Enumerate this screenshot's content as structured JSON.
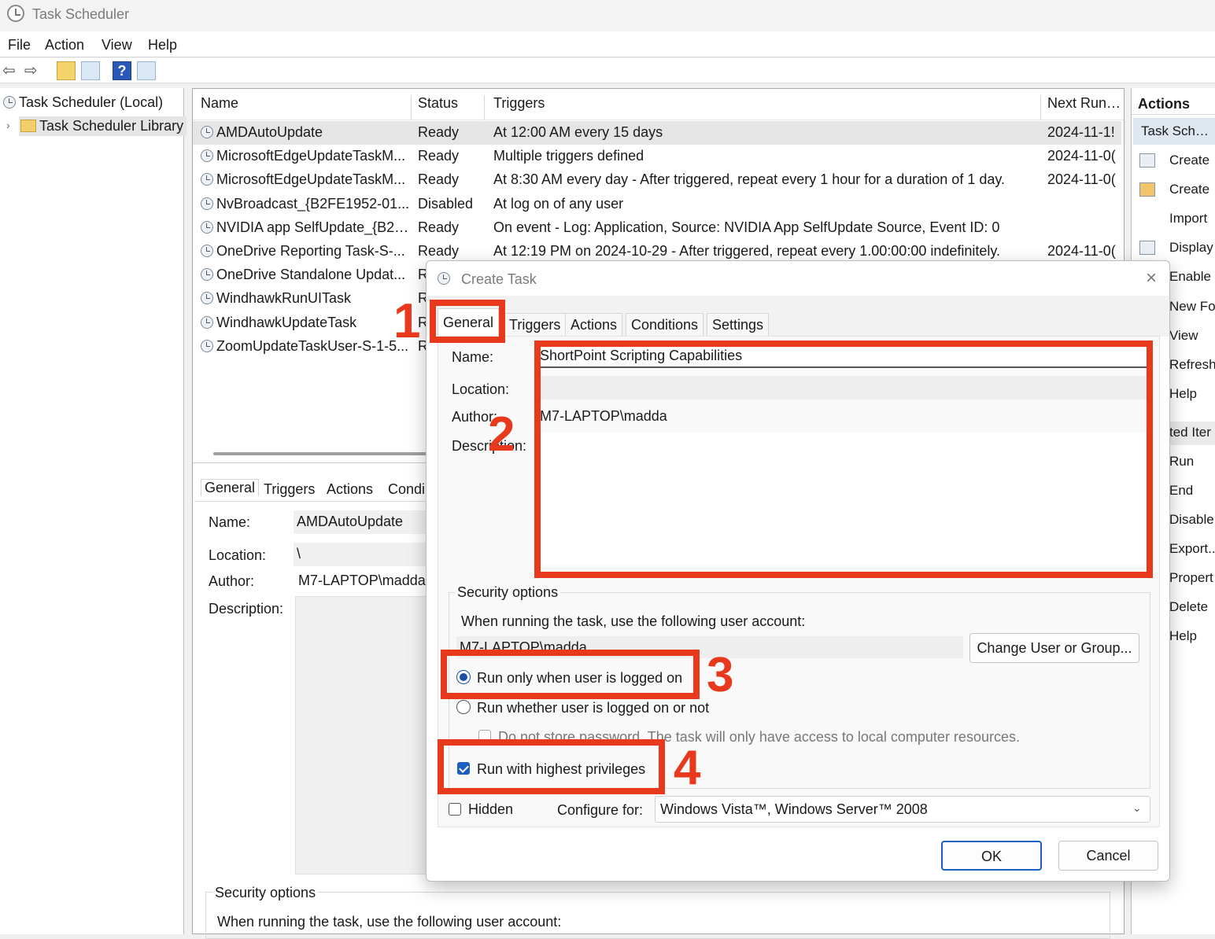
{
  "window": {
    "title": "Task Scheduler"
  },
  "menu": [
    "File",
    "Action",
    "View",
    "Help"
  ],
  "tree": {
    "root": "Task Scheduler (Local)",
    "library": "Task Scheduler Library"
  },
  "columns": {
    "name": "Name",
    "status": "Status",
    "triggers": "Triggers",
    "next_run": "Next Run Ti"
  },
  "tasks": [
    {
      "name": "AMDAutoUpdate",
      "status": "Ready",
      "triggers": "At 12:00 AM every 15 days",
      "next_run": "2024-11-1!"
    },
    {
      "name": "MicrosoftEdgeUpdateTaskM...",
      "status": "Ready",
      "triggers": "Multiple triggers defined",
      "next_run": "2024-11-0("
    },
    {
      "name": "MicrosoftEdgeUpdateTaskM...",
      "status": "Ready",
      "triggers": "At 8:30 AM every day - After triggered, repeat every 1 hour for a duration of 1 day.",
      "next_run": "2024-11-0("
    },
    {
      "name": "NvBroadcast_{B2FE1952-01...",
      "status": "Disabled",
      "triggers": "At log on of any user",
      "next_run": ""
    },
    {
      "name": "NVIDIA app SelfUpdate_{B2F...",
      "status": "Ready",
      "triggers": "On event - Log: Application, Source: NVIDIA App SelfUpdate Source, Event ID: 0",
      "next_run": ""
    },
    {
      "name": "OneDrive Reporting Task-S-...",
      "status": "Ready",
      "triggers": "At 12:19 PM on 2024-10-29 - After triggered, repeat every 1.00:00:00 indefinitely.",
      "next_run": "2024-11-0("
    },
    {
      "name": "OneDrive Standalone Updat...",
      "status": "R",
      "triggers": "",
      "next_run": ""
    },
    {
      "name": "WindhawkRunUITask",
      "status": "R",
      "triggers": "",
      "next_run": ""
    },
    {
      "name": "WindhawkUpdateTask",
      "status": "R",
      "triggers": "",
      "next_run": ""
    },
    {
      "name": "ZoomUpdateTaskUser-S-1-5...",
      "status": "R",
      "triggers": "",
      "next_run": ""
    }
  ],
  "details": {
    "tabs": [
      "General",
      "Triggers",
      "Actions",
      "Condi"
    ],
    "name_label": "Name:",
    "name_value": "AMDAutoUpdate",
    "location_label": "Location:",
    "location_value": "\\",
    "author_label": "Author:",
    "author_value": "M7-LAPTOP\\madda",
    "description_label": "Description:",
    "security_title": "Security options",
    "security_text": "When running the task, use the following user account:"
  },
  "actions_pane": {
    "title": "Actions",
    "section1": "Task Schedu",
    "items1": [
      "Create",
      "Create",
      "Import",
      "Display",
      "Enable",
      "New Fo",
      "View",
      "Refresh",
      "Help"
    ],
    "section2": "ted Iter",
    "items2": [
      "Run",
      "End",
      "Disable",
      "Export...",
      "Propert",
      "Delete",
      "Help"
    ]
  },
  "dialog": {
    "title": "Create Task",
    "tabs": [
      "General",
      "Triggers",
      "Actions",
      "Conditions",
      "Settings"
    ],
    "name_label": "Name:",
    "name_value": "ShortPoint Scripting Capabilities",
    "location_label": "Location:",
    "location_value": "",
    "author_label": "Author:",
    "author_value": "M7-LAPTOP\\madda",
    "description_label": "Description:",
    "security_title": "Security options",
    "security_text": "When running the task, use the following user account:",
    "user_account": "M7-LAPTOP\\madda",
    "change_user_button": "Change User or Group...",
    "radio_logged_on": "Run only when user is logged on",
    "radio_whether": "Run whether user is logged on or not",
    "do_not_store": "Do not store password.  The task will only have access to local computer resources.",
    "highest_privileges": "Run with highest privileges",
    "hidden_label": "Hidden",
    "configure_label": "Configure for:",
    "configure_value": "Windows Vista™, Windows Server™ 2008",
    "ok": "OK",
    "cancel": "Cancel"
  },
  "annotations": [
    "1",
    "2",
    "3",
    "4"
  ],
  "colors": {
    "highlight": "#e8391d",
    "selection": "#e5e5e5",
    "accent": "#1c4fa8"
  }
}
